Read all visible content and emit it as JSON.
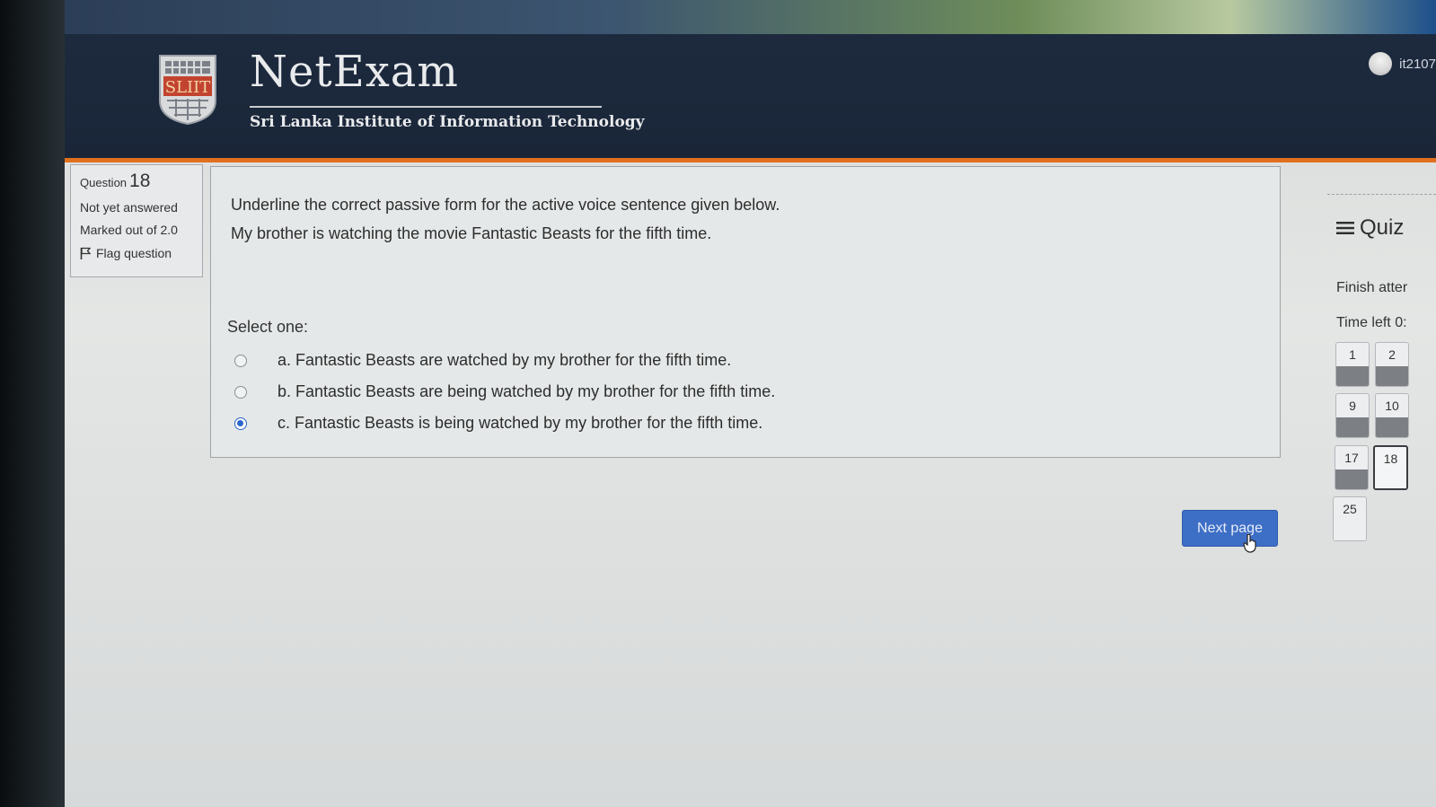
{
  "header": {
    "brand_title": "NetExam",
    "brand_subtitle": "Sri Lanka Institute of Information Technology",
    "logo_text": "SLIIT",
    "user_name": "it2107"
  },
  "question_info": {
    "label": "Question",
    "number": "18",
    "status": "Not yet answered",
    "marks": "Marked out of 2.0",
    "flag_label": "Flag question"
  },
  "question": {
    "prompt": "Underline the correct passive form for the active voice sentence given below.",
    "sentence": "My brother is watching the movie Fantastic Beasts for the fifth time.",
    "select_label": "Select one:",
    "options": [
      {
        "text": "a. Fantastic Beasts are watched by my brother for the fifth time.",
        "selected": false
      },
      {
        "text": "b. Fantastic Beasts are being watched by my brother for the fifth time.",
        "selected": false
      },
      {
        "text": "c. Fantastic Beasts is being watched by my brother for the fifth time.",
        "selected": true
      }
    ]
  },
  "next_button": "Next page",
  "quiz_nav": {
    "title": "Quiz",
    "finish": "Finish atter",
    "time_left": "Time left 0:",
    "buttons": [
      "1",
      "2",
      "9",
      "10",
      "17",
      "18",
      "25"
    ],
    "current": "18"
  },
  "colors": {
    "accent": "#3e6fc6",
    "header_bg": "#1d2a3e",
    "header_border": "#e0701e"
  }
}
